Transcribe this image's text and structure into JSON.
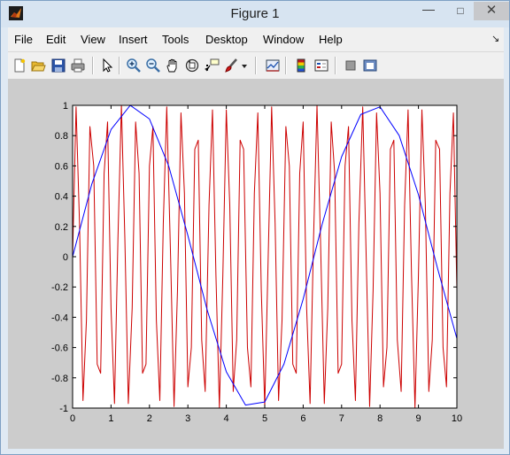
{
  "window": {
    "title": "Figure 1",
    "controls": {
      "minimize": "—",
      "maximize": "□",
      "close": "✕"
    }
  },
  "menu": {
    "items": [
      "File",
      "Edit",
      "View",
      "Insert",
      "Tools",
      "Desktop",
      "Window",
      "Help"
    ],
    "overflow_arrow": "↘"
  },
  "toolbar": {
    "buttons": [
      "new-figure-icon",
      "open-file-icon",
      "save-figure-icon",
      "print-figure-icon",
      "edit-plot-arrow-icon",
      "zoom-in-icon",
      "zoom-out-icon",
      "pan-hand-icon",
      "rotate-3d-icon",
      "data-cursor-icon",
      "brush-icon",
      "brush-dropdown-icon",
      "link-plot-icon",
      "insert-colorbar-icon",
      "insert-legend-icon",
      "hide-plot-tools-icon",
      "show-plot-tools-icon"
    ]
  },
  "chart_data": {
    "type": "line",
    "title": "",
    "xlabel": "",
    "ylabel": "",
    "xlim": [
      0,
      10
    ],
    "ylim": [
      -1,
      1
    ],
    "xticks": [
      0,
      1,
      2,
      3,
      4,
      5,
      6,
      7,
      8,
      9,
      10
    ],
    "yticks": [
      -1,
      -0.8,
      -0.6,
      -0.4,
      -0.2,
      0,
      0.2,
      0.4,
      0.6,
      0.8,
      1
    ],
    "xtick_labels": [
      "0",
      "1",
      "2",
      "3",
      "4",
      "5",
      "6",
      "7",
      "8",
      "9",
      "10"
    ],
    "ytick_labels": [
      "-1",
      "-0.8",
      "-0.6",
      "-0.4",
      "-0.2",
      "0",
      "0.2",
      "0.4",
      "0.6",
      "0.8",
      "1"
    ],
    "grid": false,
    "series": [
      {
        "color": "#0000ff",
        "x": [
          0,
          0.5,
          1,
          1.5,
          2,
          2.5,
          3,
          3.5,
          4,
          4.5,
          5,
          5.5,
          6,
          6.5,
          7,
          7.5,
          8,
          8.5,
          9,
          9.5,
          10
        ],
        "y": [
          0,
          0.48,
          0.84,
          1.0,
          0.91,
          0.6,
          0.14,
          -0.35,
          -0.76,
          -0.98,
          -0.96,
          -0.71,
          -0.28,
          0.22,
          0.66,
          0.94,
          0.99,
          0.8,
          0.41,
          -0.08,
          -0.54
        ]
      },
      {
        "color": "#cc0000",
        "x": [
          0,
          0.09,
          0.18,
          0.27,
          0.36,
          0.45,
          0.55,
          0.64,
          0.73,
          0.82,
          0.91,
          1,
          1.09,
          1.18,
          1.27,
          1.36,
          1.45,
          1.55,
          1.64,
          1.73,
          1.82,
          1.91,
          2,
          2.09,
          2.18,
          2.27,
          2.36,
          2.45,
          2.55,
          2.64,
          2.73,
          2.82,
          2.91,
          3,
          3.09,
          3.18,
          3.27,
          3.36,
          3.45,
          3.55,
          3.64,
          3.73,
          3.82,
          3.91,
          4,
          4.09,
          4.18,
          4.27,
          4.36,
          4.45,
          4.55,
          4.64,
          4.73,
          4.82,
          4.91,
          5,
          5.09,
          5.18,
          5.27,
          5.36,
          5.45,
          5.55,
          5.64,
          5.73,
          5.82,
          5.91,
          6,
          6.09,
          6.18,
          6.27,
          6.36,
          6.45,
          6.55,
          6.64,
          6.73,
          6.82,
          6.91,
          7,
          7.09,
          7.18,
          7.27,
          7.36,
          7.45,
          7.55,
          7.64,
          7.73,
          7.82,
          7.91,
          8,
          8.09,
          8.18,
          8.27,
          8.36,
          8.45,
          8.55,
          8.64,
          8.73,
          8.82,
          8.91,
          9,
          9.09,
          9.18,
          9.27,
          9.36,
          9.45,
          9.55,
          9.64,
          9.73,
          9.82,
          9.91,
          10
        ],
        "y": [
          0,
          0.99,
          0.22,
          -0.95,
          -0.42,
          0.86,
          0.6,
          -0.71,
          -0.77,
          0.55,
          0.89,
          -0.34,
          -0.97,
          0.12,
          1,
          0.12,
          -0.97,
          -0.34,
          0.89,
          0.55,
          -0.77,
          -0.71,
          0.6,
          0.86,
          -0.42,
          -0.95,
          0.22,
          0.99,
          0,
          -0.99,
          -0.22,
          0.95,
          0.42,
          -0.86,
          -0.6,
          0.71,
          0.77,
          -0.55,
          -0.89,
          0.34,
          0.97,
          -0.12,
          -1,
          -0.12,
          0.97,
          0.34,
          -0.89,
          -0.55,
          0.77,
          0.71,
          -0.6,
          -0.86,
          0.42,
          0.95,
          -0.22,
          -0.99,
          0,
          0.99,
          0.22,
          -0.95,
          -0.42,
          0.86,
          0.6,
          -0.71,
          -0.77,
          0.55,
          0.89,
          -0.34,
          -0.97,
          0.12,
          1,
          0.12,
          -0.97,
          -0.34,
          0.89,
          0.55,
          -0.77,
          -0.71,
          0.6,
          0.86,
          -0.42,
          -0.95,
          0.22,
          0.99,
          0,
          -0.99,
          -0.22,
          0.95,
          0.42,
          -0.86,
          -0.6,
          0.71,
          0.77,
          -0.55,
          -0.89,
          0.34,
          0.97,
          -0.12,
          -1,
          -0.12,
          0.97,
          0.34,
          -0.89,
          -0.55,
          0.77,
          0.71,
          -0.6,
          -0.86,
          0.42,
          0.95,
          -0.22
        ]
      }
    ]
  }
}
